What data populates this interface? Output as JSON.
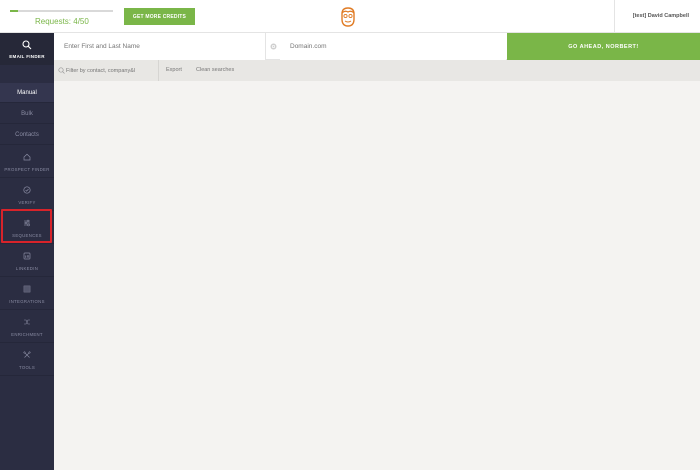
{
  "header": {
    "requests_label": "Requests: 4/50",
    "requests_used": 4,
    "requests_limit": 50,
    "credits_button": "GET MORE CREDITS",
    "user_name": "[test] David Campbell"
  },
  "sidebar": {
    "email_finder_label": "EMAIL FINDER",
    "text_items": [
      "Manual",
      "Bulk",
      "Contacts"
    ],
    "groups": [
      {
        "label": "PROSPECT FINDER",
        "icon": "home-icon"
      },
      {
        "label": "VERIFY",
        "icon": "check-circle-icon"
      },
      {
        "label": "SEQUENCES",
        "icon": "sliders-icon"
      },
      {
        "label": "LINKEDIN",
        "icon": "linkedin-icon"
      },
      {
        "label": "INTEGRATIONS",
        "icon": "grid-icon"
      },
      {
        "label": "ENRICHMENT",
        "icon": "shuffle-icon"
      },
      {
        "label": "TOOLS",
        "icon": "tools-icon"
      }
    ]
  },
  "search": {
    "name_placeholder": "Enter First and Last Name",
    "domain_placeholder": "Domain.com",
    "go_button": "GO AHEAD, NORBERT!"
  },
  "filter": {
    "placeholder": "Filter by contact, company&l",
    "export_label": "Export",
    "clean_label": "Clean searches"
  },
  "colors": {
    "accent_green": "#7ab648",
    "sidebar_bg": "#2b2d42",
    "annotation_red": "#d8232a",
    "logo_orange": "#e07b24"
  }
}
